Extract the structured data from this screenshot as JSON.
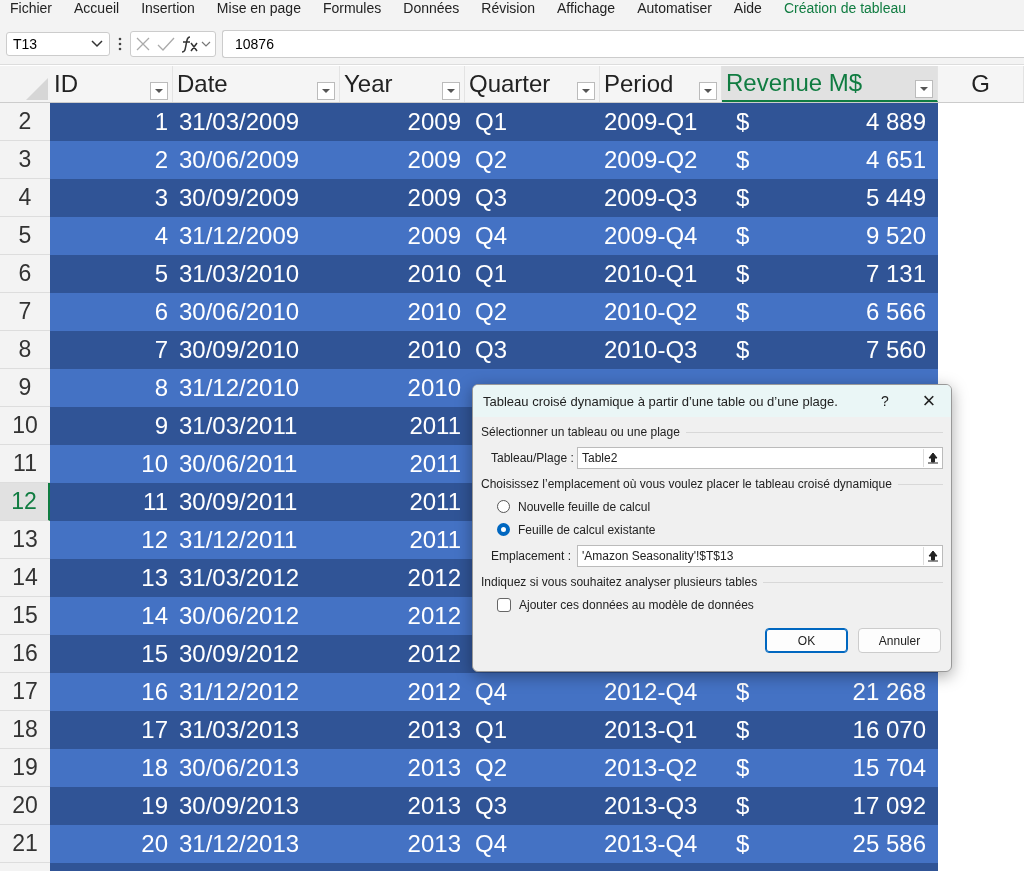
{
  "ribbon_tabs": [
    {
      "label": "Fichier",
      "selected": false
    },
    {
      "label": "Accueil",
      "selected": false
    },
    {
      "label": "Insertion",
      "selected": false
    },
    {
      "label": "Mise en page",
      "selected": false
    },
    {
      "label": "Formules",
      "selected": false
    },
    {
      "label": "Données",
      "selected": false
    },
    {
      "label": "Révision",
      "selected": false
    },
    {
      "label": "Affichage",
      "selected": false
    },
    {
      "label": "Automatiser",
      "selected": false
    },
    {
      "label": "Aide",
      "selected": false
    },
    {
      "label": "Création de tableau",
      "selected": true
    }
  ],
  "formula_bar": {
    "name_box": "T13",
    "value": "10876"
  },
  "columns": [
    {
      "label": "ID",
      "selected": false,
      "filter": true
    },
    {
      "label": "Date",
      "selected": false,
      "filter": true
    },
    {
      "label": "Year",
      "selected": false,
      "filter": true
    },
    {
      "label": "Quarter",
      "selected": false,
      "filter": true
    },
    {
      "label": "Period",
      "selected": false,
      "filter": true
    },
    {
      "label": "Revenue M$",
      "selected": true,
      "filter": true
    },
    {
      "label": "G",
      "selected": false,
      "filter": false
    }
  ],
  "rows": [
    {
      "num": "2",
      "selected": false,
      "id": "1",
      "date": "31/03/2009",
      "year": "2009",
      "quarter": "Q1",
      "period": "2009-Q1",
      "currency": "$",
      "revenue": "4 889"
    },
    {
      "num": "3",
      "selected": false,
      "id": "2",
      "date": "30/06/2009",
      "year": "2009",
      "quarter": "Q2",
      "period": "2009-Q2",
      "currency": "$",
      "revenue": "4 651"
    },
    {
      "num": "4",
      "selected": false,
      "id": "3",
      "date": "30/09/2009",
      "year": "2009",
      "quarter": "Q3",
      "period": "2009-Q3",
      "currency": "$",
      "revenue": "5 449"
    },
    {
      "num": "5",
      "selected": false,
      "id": "4",
      "date": "31/12/2009",
      "year": "2009",
      "quarter": "Q4",
      "period": "2009-Q4",
      "currency": "$",
      "revenue": "9 520"
    },
    {
      "num": "6",
      "selected": false,
      "id": "5",
      "date": "31/03/2010",
      "year": "2010",
      "quarter": "Q1",
      "period": "2010-Q1",
      "currency": "$",
      "revenue": "7 131"
    },
    {
      "num": "7",
      "selected": false,
      "id": "6",
      "date": "30/06/2010",
      "year": "2010",
      "quarter": "Q2",
      "period": "2010-Q2",
      "currency": "$",
      "revenue": "6 566"
    },
    {
      "num": "8",
      "selected": false,
      "id": "7",
      "date": "30/09/2010",
      "year": "2010",
      "quarter": "Q3",
      "period": "2010-Q3",
      "currency": "$",
      "revenue": "7 560"
    },
    {
      "num": "9",
      "selected": false,
      "id": "8",
      "date": "31/12/2010",
      "year": "2010"
    },
    {
      "num": "10",
      "selected": false,
      "id": "9",
      "date": "31/03/2011",
      "year": "2011"
    },
    {
      "num": "11",
      "selected": false,
      "id": "10",
      "date": "30/06/2011",
      "year": "2011"
    },
    {
      "num": "12",
      "selected": true,
      "id": "11",
      "date": "30/09/2011",
      "year": "2011"
    },
    {
      "num": "13",
      "selected": false,
      "id": "12",
      "date": "31/12/2011",
      "year": "2011"
    },
    {
      "num": "14",
      "selected": false,
      "id": "13",
      "date": "31/03/2012",
      "year": "2012"
    },
    {
      "num": "15",
      "selected": false,
      "id": "14",
      "date": "30/06/2012",
      "year": "2012"
    },
    {
      "num": "16",
      "selected": false,
      "id": "15",
      "date": "30/09/2012",
      "year": "2012"
    },
    {
      "num": "17",
      "selected": false,
      "id": "16",
      "date": "31/12/2012",
      "year": "2012",
      "quarter": "Q4",
      "period": "2012-Q4",
      "currency": "$",
      "revenue": "21 268"
    },
    {
      "num": "18",
      "selected": false,
      "id": "17",
      "date": "31/03/2013",
      "year": "2013",
      "quarter": "Q1",
      "period": "2013-Q1",
      "currency": "$",
      "revenue": "16 070"
    },
    {
      "num": "19",
      "selected": false,
      "id": "18",
      "date": "30/06/2013",
      "year": "2013",
      "quarter": "Q2",
      "period": "2013-Q2",
      "currency": "$",
      "revenue": "15 704"
    },
    {
      "num": "20",
      "selected": false,
      "id": "19",
      "date": "30/09/2013",
      "year": "2013",
      "quarter": "Q3",
      "period": "2013-Q3",
      "currency": "$",
      "revenue": "17 092"
    },
    {
      "num": "21",
      "selected": false,
      "id": "20",
      "date": "31/12/2013",
      "year": "2013",
      "quarter": "Q4",
      "period": "2013-Q4",
      "currency": "$",
      "revenue": "25 586"
    }
  ],
  "dialog": {
    "title": "Tableau croisé dynamique à partir d’une table ou d’une plage.",
    "help": "?",
    "close": "×",
    "section_1": "Sélectionner un tableau ou une plage",
    "range_label": "Tableau/Plage :",
    "range_value": "Table2",
    "section_2": "Choisissez l’emplacement où vous voulez placer le tableau croisé dynamique",
    "destinations": [
      {
        "label": "Nouvelle feuille de calcul",
        "selected": false
      },
      {
        "label": "Feuille de calcul existante",
        "selected": true
      }
    ],
    "location_label": "Emplacement :",
    "location_value": "'Amazon Seasonality'!$T$13",
    "section_3": "Indiquez si vous souhaitez analyser plusieurs tables",
    "data_model": {
      "label": "Ajouter ces données au modèle de données",
      "checked": false
    },
    "buttons": [
      {
        "label": "OK",
        "kind": "default"
      },
      {
        "label": "Annuler",
        "kind": "normal"
      }
    ]
  }
}
